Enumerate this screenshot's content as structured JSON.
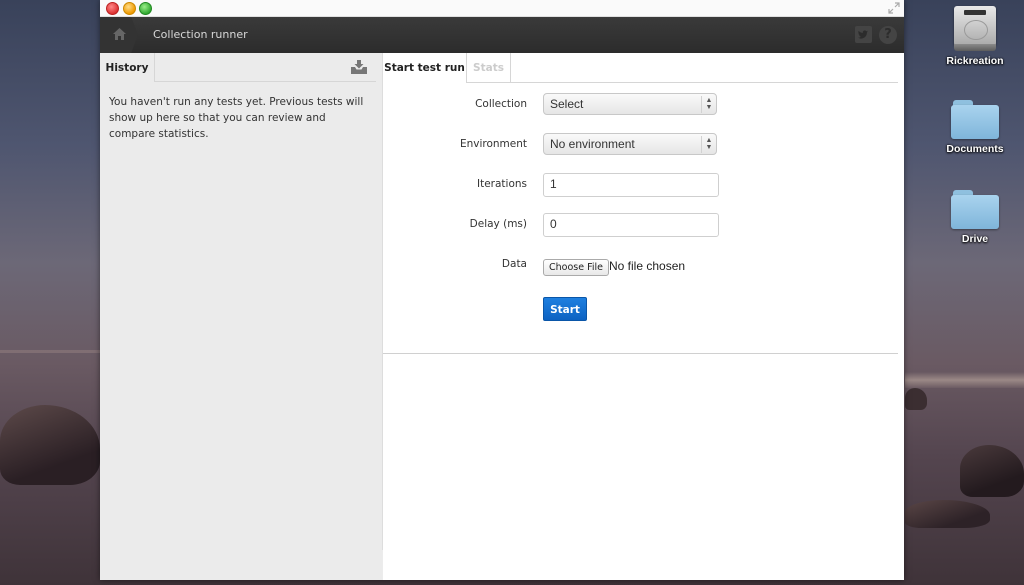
{
  "desktop": {
    "icons": [
      {
        "label": "Rickreation",
        "icon": "hard-drive-icon"
      },
      {
        "label": "Documents",
        "icon": "folder-icon"
      },
      {
        "label": "Drive",
        "icon": "folder-icon"
      }
    ]
  },
  "window": {
    "controls": [
      "close",
      "minimize",
      "maximize",
      "fullscreen"
    ]
  },
  "appbar": {
    "title": "Collection runner",
    "home_icon": "home-icon",
    "twitter_icon": "twitter-icon",
    "help_label": "?"
  },
  "history": {
    "tab_label": "History",
    "import_icon": "import-icon",
    "empty_message": "You haven't run any tests yet. Previous tests will show up here so that you can review and compare statistics."
  },
  "main": {
    "tabs": [
      {
        "label": "Start test run",
        "active": true
      },
      {
        "label": "Stats",
        "active": false
      }
    ],
    "form": {
      "collection_label": "Collection",
      "collection_value": "Select",
      "environment_label": "Environment",
      "environment_value": "No environment",
      "iterations_label": "Iterations",
      "iterations_value": "1",
      "delay_label": "Delay (ms)",
      "delay_value": "0",
      "data_label": "Data",
      "choose_file_label": "Choose File",
      "file_status": "No file chosen",
      "start_label": "Start"
    }
  },
  "colors": {
    "accent": "#1a73d4",
    "appbar": "#2f2f2f",
    "sidebar": "#ebebeb"
  }
}
